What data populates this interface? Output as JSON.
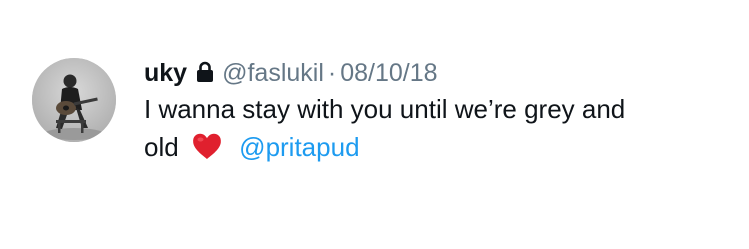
{
  "tweet": {
    "display_name": "uky",
    "handle": "@faslukil",
    "separator": "·",
    "date": "08/10/18",
    "text_line_1": "I wanna stay with you until we’re grey and",
    "text_line_2": "old",
    "mention": "@pritapud"
  },
  "icons": {
    "lock": "lock-icon",
    "heart": "red-heart-emoji"
  },
  "colors": {
    "text": "#0f1419",
    "secondary": "#657786",
    "mention": "#1d9bf0",
    "heart": "#e0202e"
  }
}
